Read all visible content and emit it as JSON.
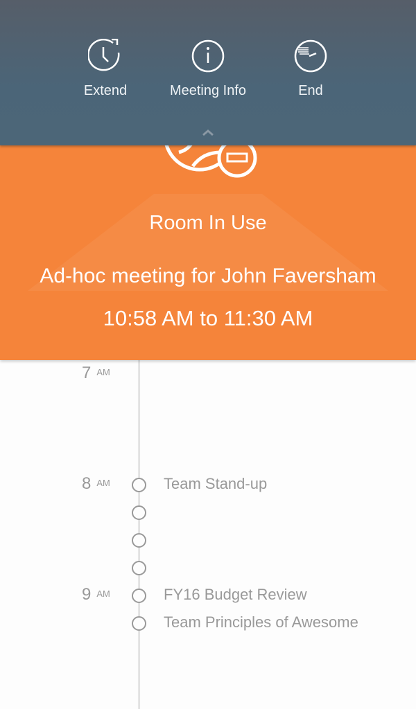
{
  "actions": [
    {
      "label": "Extend",
      "icon": "clock-extend-icon"
    },
    {
      "label": "Meeting Info",
      "icon": "info-icon"
    },
    {
      "label": "End",
      "icon": "clock-end-icon"
    }
  ],
  "banner": {
    "status": "Room In Use",
    "title": "Ad-hoc meeting for John Faversham",
    "start": "10:58 AM",
    "to": "to",
    "end": "11:30 AM",
    "color": "#f5843a"
  },
  "timeline": {
    "hours": [
      {
        "h": "7",
        "ampm": "AM"
      },
      {
        "h": "8",
        "ampm": "AM"
      },
      {
        "h": "9",
        "ampm": "AM"
      }
    ],
    "events": [
      "Team Stand-up",
      "FY16 Budget Review",
      "Team Principles of Awesome"
    ]
  }
}
